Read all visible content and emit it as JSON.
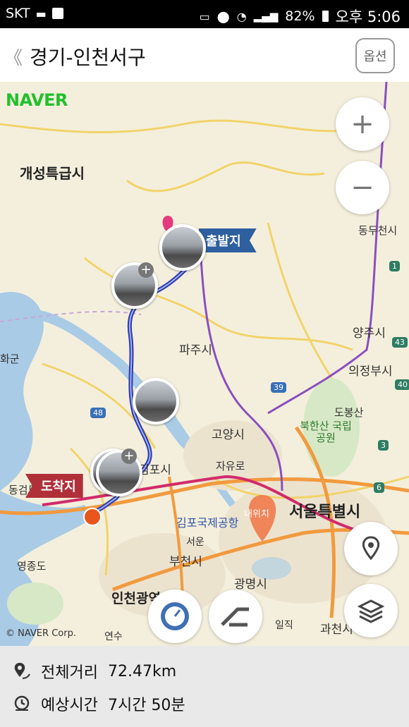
{
  "status_bar": {
    "carrier": "SKT",
    "battery": "82%",
    "time": "오후 5:06"
  },
  "header": {
    "back": "《",
    "title": "경기-인천서구",
    "option_label": "옵션"
  },
  "map": {
    "brand": "NAVER",
    "copyright": "© NAVER Corp.",
    "start_flag": "출발지",
    "end_flag": "도착지",
    "zoom_in": "+",
    "zoom_out": "−",
    "places": {
      "kaesong": "개성특급시",
      "paju": "파주시",
      "goyang": "고양시",
      "gimpo": "김포시",
      "seoul": "서울특별시",
      "gimpo_airport": "김포국제공항",
      "bucheon": "부천시",
      "gwangmyeong": "광명시",
      "incheon": "인천광역시",
      "yangju": "양주시",
      "uijeongbu": "의정부시",
      "dobongsan": "도봉산",
      "bukhansan": "북한산 국립공원",
      "gwacheon": "과천시",
      "donggeom": "동검도",
      "yeongjong": "영종도",
      "ganghwa": "화군",
      "dongducheon": "동두천시",
      "jayuro": "자유로",
      "seoseo": "서운",
      "ilchik": "일직",
      "yeonsu": "연수",
      "my_location": "내위치"
    },
    "road_labels": {
      "r39": "39",
      "r48": "48",
      "r3": "3",
      "r6": "6",
      "r1": "1",
      "r43": "43",
      "r40": "40"
    }
  },
  "summary": {
    "distance_label": "전체거리",
    "distance_value": "72.47km",
    "time_label": "예상시간",
    "time_value": "7시간 50분"
  }
}
